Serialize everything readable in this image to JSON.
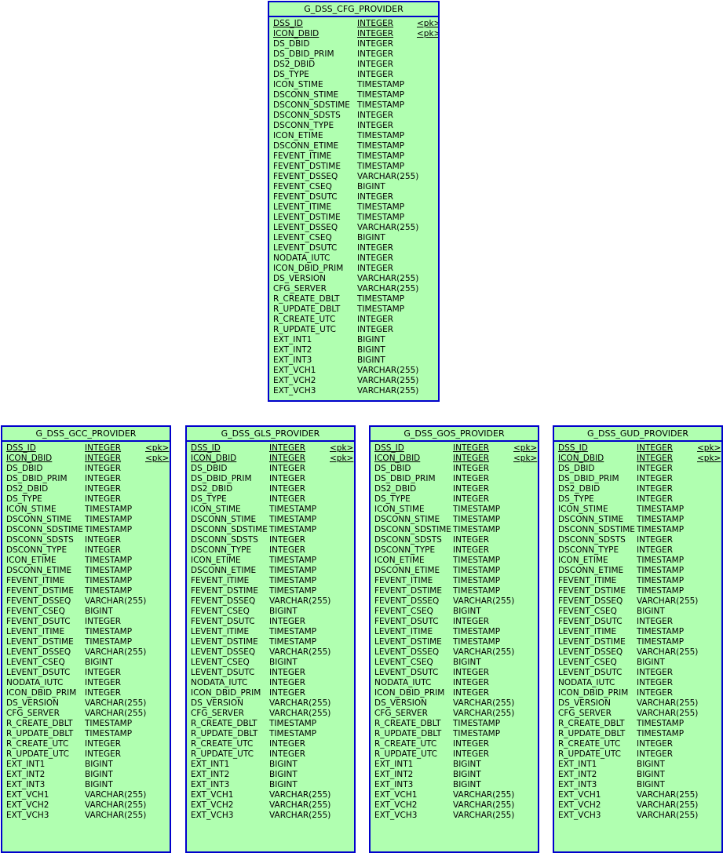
{
  "diagram": {
    "type": "entity-relationship-diagram",
    "entity_fill_color": "#b0ffb0",
    "entity_border_color": "#0000cc",
    "background_color": "#ffffff",
    "key_marker": "<pk>"
  },
  "entities": [
    {
      "id": "cfg",
      "name": "G_DSS_CFG_PROVIDER",
      "attributes": [
        {
          "name": "DSS_ID",
          "type": "INTEGER",
          "key": "<pk>"
        },
        {
          "name": "ICON_DBID",
          "type": "INTEGER",
          "key": "<pk>"
        },
        {
          "name": "DS_DBID",
          "type": "INTEGER",
          "key": ""
        },
        {
          "name": "DS_DBID_PRIM",
          "type": "INTEGER",
          "key": ""
        },
        {
          "name": "DS2_DBID",
          "type": "INTEGER",
          "key": ""
        },
        {
          "name": "DS_TYPE",
          "type": "INTEGER",
          "key": ""
        },
        {
          "name": "ICON_STIME",
          "type": "TIMESTAMP",
          "key": ""
        },
        {
          "name": "DSCONN_STIME",
          "type": "TIMESTAMP",
          "key": ""
        },
        {
          "name": "DSCONN_SDSTIME",
          "type": "TIMESTAMP",
          "key": ""
        },
        {
          "name": "DSCONN_SDSTS",
          "type": "INTEGER",
          "key": ""
        },
        {
          "name": "DSCONN_TYPE",
          "type": "INTEGER",
          "key": ""
        },
        {
          "name": "ICON_ETIME",
          "type": "TIMESTAMP",
          "key": ""
        },
        {
          "name": "DSCONN_ETIME",
          "type": "TIMESTAMP",
          "key": ""
        },
        {
          "name": "FEVENT_ITIME",
          "type": "TIMESTAMP",
          "key": ""
        },
        {
          "name": "FEVENT_DSTIME",
          "type": "TIMESTAMP",
          "key": ""
        },
        {
          "name": "FEVENT_DSSEQ",
          "type": "VARCHAR(255)",
          "key": ""
        },
        {
          "name": "FEVENT_CSEQ",
          "type": "BIGINT",
          "key": ""
        },
        {
          "name": "FEVENT_DSUTC",
          "type": "INTEGER",
          "key": ""
        },
        {
          "name": "LEVENT_ITIME",
          "type": "TIMESTAMP",
          "key": ""
        },
        {
          "name": "LEVENT_DSTIME",
          "type": "TIMESTAMP",
          "key": ""
        },
        {
          "name": "LEVENT_DSSEQ",
          "type": "VARCHAR(255)",
          "key": ""
        },
        {
          "name": "LEVENT_CSEQ",
          "type": "BIGINT",
          "key": ""
        },
        {
          "name": "LEVENT_DSUTC",
          "type": "INTEGER",
          "key": ""
        },
        {
          "name": "NODATA_IUTC",
          "type": "INTEGER",
          "key": ""
        },
        {
          "name": "ICON_DBID_PRIM",
          "type": "INTEGER",
          "key": ""
        },
        {
          "name": "DS_VERSION",
          "type": "VARCHAR(255)",
          "key": ""
        },
        {
          "name": "CFG_SERVER",
          "type": "VARCHAR(255)",
          "key": ""
        },
        {
          "name": "R_CREATE_DBLT",
          "type": "TIMESTAMP",
          "key": ""
        },
        {
          "name": "R_UPDATE_DBLT",
          "type": "TIMESTAMP",
          "key": ""
        },
        {
          "name": "R_CREATE_UTC",
          "type": "INTEGER",
          "key": ""
        },
        {
          "name": "R_UPDATE_UTC",
          "type": "INTEGER",
          "key": ""
        },
        {
          "name": "EXT_INT1",
          "type": "BIGINT",
          "key": ""
        },
        {
          "name": "EXT_INT2",
          "type": "BIGINT",
          "key": ""
        },
        {
          "name": "EXT_INT3",
          "type": "BIGINT",
          "key": ""
        },
        {
          "name": "EXT_VCH1",
          "type": "VARCHAR(255)",
          "key": ""
        },
        {
          "name": "EXT_VCH2",
          "type": "VARCHAR(255)",
          "key": ""
        },
        {
          "name": "EXT_VCH3",
          "type": "VARCHAR(255)",
          "key": ""
        }
      ]
    },
    {
      "id": "gcc",
      "name": "G_DSS_GCC_PROVIDER",
      "attributes": [
        {
          "name": "DSS_ID",
          "type": "INTEGER",
          "key": "<pk>"
        },
        {
          "name": "ICON_DBID",
          "type": "INTEGER",
          "key": "<pk>"
        },
        {
          "name": "DS_DBID",
          "type": "INTEGER",
          "key": ""
        },
        {
          "name": "DS_DBID_PRIM",
          "type": "INTEGER",
          "key": ""
        },
        {
          "name": "DS2_DBID",
          "type": "INTEGER",
          "key": ""
        },
        {
          "name": "DS_TYPE",
          "type": "INTEGER",
          "key": ""
        },
        {
          "name": "ICON_STIME",
          "type": "TIMESTAMP",
          "key": ""
        },
        {
          "name": "DSCONN_STIME",
          "type": "TIMESTAMP",
          "key": ""
        },
        {
          "name": "DSCONN_SDSTIME",
          "type": "TIMESTAMP",
          "key": ""
        },
        {
          "name": "DSCONN_SDSTS",
          "type": "INTEGER",
          "key": ""
        },
        {
          "name": "DSCONN_TYPE",
          "type": "INTEGER",
          "key": ""
        },
        {
          "name": "ICON_ETIME",
          "type": "TIMESTAMP",
          "key": ""
        },
        {
          "name": "DSCONN_ETIME",
          "type": "TIMESTAMP",
          "key": ""
        },
        {
          "name": "FEVENT_ITIME",
          "type": "TIMESTAMP",
          "key": ""
        },
        {
          "name": "FEVENT_DSTIME",
          "type": "TIMESTAMP",
          "key": ""
        },
        {
          "name": "FEVENT_DSSEQ",
          "type": "VARCHAR(255)",
          "key": ""
        },
        {
          "name": "FEVENT_CSEQ",
          "type": "BIGINT",
          "key": ""
        },
        {
          "name": "FEVENT_DSUTC",
          "type": "INTEGER",
          "key": ""
        },
        {
          "name": "LEVENT_ITIME",
          "type": "TIMESTAMP",
          "key": ""
        },
        {
          "name": "LEVENT_DSTIME",
          "type": "TIMESTAMP",
          "key": ""
        },
        {
          "name": "LEVENT_DSSEQ",
          "type": "VARCHAR(255)",
          "key": ""
        },
        {
          "name": "LEVENT_CSEQ",
          "type": "BIGINT",
          "key": ""
        },
        {
          "name": "LEVENT_DSUTC",
          "type": "INTEGER",
          "key": ""
        },
        {
          "name": "NODATA_IUTC",
          "type": "INTEGER",
          "key": ""
        },
        {
          "name": "ICON_DBID_PRIM",
          "type": "INTEGER",
          "key": ""
        },
        {
          "name": "DS_VERSION",
          "type": "VARCHAR(255)",
          "key": ""
        },
        {
          "name": "CFG_SERVER",
          "type": "VARCHAR(255)",
          "key": ""
        },
        {
          "name": "R_CREATE_DBLT",
          "type": "TIMESTAMP",
          "key": ""
        },
        {
          "name": "R_UPDATE_DBLT",
          "type": "TIMESTAMP",
          "key": ""
        },
        {
          "name": "R_CREATE_UTC",
          "type": "INTEGER",
          "key": ""
        },
        {
          "name": "R_UPDATE_UTC",
          "type": "INTEGER",
          "key": ""
        },
        {
          "name": "EXT_INT1",
          "type": "BIGINT",
          "key": ""
        },
        {
          "name": "EXT_INT2",
          "type": "BIGINT",
          "key": ""
        },
        {
          "name": "EXT_INT3",
          "type": "BIGINT",
          "key": ""
        },
        {
          "name": "EXT_VCH1",
          "type": "VARCHAR(255)",
          "key": ""
        },
        {
          "name": "EXT_VCH2",
          "type": "VARCHAR(255)",
          "key": ""
        },
        {
          "name": "EXT_VCH3",
          "type": "VARCHAR(255)",
          "key": ""
        }
      ]
    },
    {
      "id": "gls",
      "name": "G_DSS_GLS_PROVIDER",
      "attributes": [
        {
          "name": "DSS_ID",
          "type": "INTEGER",
          "key": "<pk>"
        },
        {
          "name": "ICON_DBID",
          "type": "INTEGER",
          "key": "<pk>"
        },
        {
          "name": "DS_DBID",
          "type": "INTEGER",
          "key": ""
        },
        {
          "name": "DS_DBID_PRIM",
          "type": "INTEGER",
          "key": ""
        },
        {
          "name": "DS2_DBID",
          "type": "INTEGER",
          "key": ""
        },
        {
          "name": "DS_TYPE",
          "type": "INTEGER",
          "key": ""
        },
        {
          "name": "ICON_STIME",
          "type": "TIMESTAMP",
          "key": ""
        },
        {
          "name": "DSCONN_STIME",
          "type": "TIMESTAMP",
          "key": ""
        },
        {
          "name": "DSCONN_SDSTIME",
          "type": "TIMESTAMP",
          "key": ""
        },
        {
          "name": "DSCONN_SDSTS",
          "type": "INTEGER",
          "key": ""
        },
        {
          "name": "DSCONN_TYPE",
          "type": "INTEGER",
          "key": ""
        },
        {
          "name": "ICON_ETIME",
          "type": "TIMESTAMP",
          "key": ""
        },
        {
          "name": "DSCONN_ETIME",
          "type": "TIMESTAMP",
          "key": ""
        },
        {
          "name": "FEVENT_ITIME",
          "type": "TIMESTAMP",
          "key": ""
        },
        {
          "name": "FEVENT_DSTIME",
          "type": "TIMESTAMP",
          "key": ""
        },
        {
          "name": "FEVENT_DSSEQ",
          "type": "VARCHAR(255)",
          "key": ""
        },
        {
          "name": "FEVENT_CSEQ",
          "type": "BIGINT",
          "key": ""
        },
        {
          "name": "FEVENT_DSUTC",
          "type": "INTEGER",
          "key": ""
        },
        {
          "name": "LEVENT_ITIME",
          "type": "TIMESTAMP",
          "key": ""
        },
        {
          "name": "LEVENT_DSTIME",
          "type": "TIMESTAMP",
          "key": ""
        },
        {
          "name": "LEVENT_DSSEQ",
          "type": "VARCHAR(255)",
          "key": ""
        },
        {
          "name": "LEVENT_CSEQ",
          "type": "BIGINT",
          "key": ""
        },
        {
          "name": "LEVENT_DSUTC",
          "type": "INTEGER",
          "key": ""
        },
        {
          "name": "NODATA_IUTC",
          "type": "INTEGER",
          "key": ""
        },
        {
          "name": "ICON_DBID_PRIM",
          "type": "INTEGER",
          "key": ""
        },
        {
          "name": "DS_VERSION",
          "type": "VARCHAR(255)",
          "key": ""
        },
        {
          "name": "CFG_SERVER",
          "type": "VARCHAR(255)",
          "key": ""
        },
        {
          "name": "R_CREATE_DBLT",
          "type": "TIMESTAMP",
          "key": ""
        },
        {
          "name": "R_UPDATE_DBLT",
          "type": "TIMESTAMP",
          "key": ""
        },
        {
          "name": "R_CREATE_UTC",
          "type": "INTEGER",
          "key": ""
        },
        {
          "name": "R_UPDATE_UTC",
          "type": "INTEGER",
          "key": ""
        },
        {
          "name": "EXT_INT1",
          "type": "BIGINT",
          "key": ""
        },
        {
          "name": "EXT_INT2",
          "type": "BIGINT",
          "key": ""
        },
        {
          "name": "EXT_INT3",
          "type": "BIGINT",
          "key": ""
        },
        {
          "name": "EXT_VCH1",
          "type": "VARCHAR(255)",
          "key": ""
        },
        {
          "name": "EXT_VCH2",
          "type": "VARCHAR(255)",
          "key": ""
        },
        {
          "name": "EXT_VCH3",
          "type": "VARCHAR(255)",
          "key": ""
        }
      ]
    },
    {
      "id": "gos",
      "name": "G_DSS_GOS_PROVIDER",
      "attributes": [
        {
          "name": "DSS_ID",
          "type": "INTEGER",
          "key": "<pk>"
        },
        {
          "name": "ICON_DBID",
          "type": "INTEGER",
          "key": "<pk>"
        },
        {
          "name": "DS_DBID",
          "type": "INTEGER",
          "key": ""
        },
        {
          "name": "DS_DBID_PRIM",
          "type": "INTEGER",
          "key": ""
        },
        {
          "name": "DS2_DBID",
          "type": "INTEGER",
          "key": ""
        },
        {
          "name": "DS_TYPE",
          "type": "INTEGER",
          "key": ""
        },
        {
          "name": "ICON_STIME",
          "type": "TIMESTAMP",
          "key": ""
        },
        {
          "name": "DSCONN_STIME",
          "type": "TIMESTAMP",
          "key": ""
        },
        {
          "name": "DSCONN_SDSTIME",
          "type": "TIMESTAMP",
          "key": ""
        },
        {
          "name": "DSCONN_SDSTS",
          "type": "INTEGER",
          "key": ""
        },
        {
          "name": "DSCONN_TYPE",
          "type": "INTEGER",
          "key": ""
        },
        {
          "name": "ICON_ETIME",
          "type": "TIMESTAMP",
          "key": ""
        },
        {
          "name": "DSCONN_ETIME",
          "type": "TIMESTAMP",
          "key": ""
        },
        {
          "name": "FEVENT_ITIME",
          "type": "TIMESTAMP",
          "key": ""
        },
        {
          "name": "FEVENT_DSTIME",
          "type": "TIMESTAMP",
          "key": ""
        },
        {
          "name": "FEVENT_DSSEQ",
          "type": "VARCHAR(255)",
          "key": ""
        },
        {
          "name": "FEVENT_CSEQ",
          "type": "BIGINT",
          "key": ""
        },
        {
          "name": "FEVENT_DSUTC",
          "type": "INTEGER",
          "key": ""
        },
        {
          "name": "LEVENT_ITIME",
          "type": "TIMESTAMP",
          "key": ""
        },
        {
          "name": "LEVENT_DSTIME",
          "type": "TIMESTAMP",
          "key": ""
        },
        {
          "name": "LEVENT_DSSEQ",
          "type": "VARCHAR(255)",
          "key": ""
        },
        {
          "name": "LEVENT_CSEQ",
          "type": "BIGINT",
          "key": ""
        },
        {
          "name": "LEVENT_DSUTC",
          "type": "INTEGER",
          "key": ""
        },
        {
          "name": "NODATA_IUTC",
          "type": "INTEGER",
          "key": ""
        },
        {
          "name": "ICON_DBID_PRIM",
          "type": "INTEGER",
          "key": ""
        },
        {
          "name": "DS_VERSION",
          "type": "VARCHAR(255)",
          "key": ""
        },
        {
          "name": "CFG_SERVER",
          "type": "VARCHAR(255)",
          "key": ""
        },
        {
          "name": "R_CREATE_DBLT",
          "type": "TIMESTAMP",
          "key": ""
        },
        {
          "name": "R_UPDATE_DBLT",
          "type": "TIMESTAMP",
          "key": ""
        },
        {
          "name": "R_CREATE_UTC",
          "type": "INTEGER",
          "key": ""
        },
        {
          "name": "R_UPDATE_UTC",
          "type": "INTEGER",
          "key": ""
        },
        {
          "name": "EXT_INT1",
          "type": "BIGINT",
          "key": ""
        },
        {
          "name": "EXT_INT2",
          "type": "BIGINT",
          "key": ""
        },
        {
          "name": "EXT_INT3",
          "type": "BIGINT",
          "key": ""
        },
        {
          "name": "EXT_VCH1",
          "type": "VARCHAR(255)",
          "key": ""
        },
        {
          "name": "EXT_VCH2",
          "type": "VARCHAR(255)",
          "key": ""
        },
        {
          "name": "EXT_VCH3",
          "type": "VARCHAR(255)",
          "key": ""
        }
      ]
    },
    {
      "id": "gud",
      "name": "G_DSS_GUD_PROVIDER",
      "attributes": [
        {
          "name": "DSS_ID",
          "type": "INTEGER",
          "key": "<pk>"
        },
        {
          "name": "ICON_DBID",
          "type": "INTEGER",
          "key": "<pk>"
        },
        {
          "name": "DS_DBID",
          "type": "INTEGER",
          "key": ""
        },
        {
          "name": "DS_DBID_PRIM",
          "type": "INTEGER",
          "key": ""
        },
        {
          "name": "DS2_DBID",
          "type": "INTEGER",
          "key": ""
        },
        {
          "name": "DS_TYPE",
          "type": "INTEGER",
          "key": ""
        },
        {
          "name": "ICON_STIME",
          "type": "TIMESTAMP",
          "key": ""
        },
        {
          "name": "DSCONN_STIME",
          "type": "TIMESTAMP",
          "key": ""
        },
        {
          "name": "DSCONN_SDSTIME",
          "type": "TIMESTAMP",
          "key": ""
        },
        {
          "name": "DSCONN_SDSTS",
          "type": "INTEGER",
          "key": ""
        },
        {
          "name": "DSCONN_TYPE",
          "type": "INTEGER",
          "key": ""
        },
        {
          "name": "ICON_ETIME",
          "type": "TIMESTAMP",
          "key": ""
        },
        {
          "name": "DSCONN_ETIME",
          "type": "TIMESTAMP",
          "key": ""
        },
        {
          "name": "FEVENT_ITIME",
          "type": "TIMESTAMP",
          "key": ""
        },
        {
          "name": "FEVENT_DSTIME",
          "type": "TIMESTAMP",
          "key": ""
        },
        {
          "name": "FEVENT_DSSEQ",
          "type": "VARCHAR(255)",
          "key": ""
        },
        {
          "name": "FEVENT_CSEQ",
          "type": "BIGINT",
          "key": ""
        },
        {
          "name": "FEVENT_DSUTC",
          "type": "INTEGER",
          "key": ""
        },
        {
          "name": "LEVENT_ITIME",
          "type": "TIMESTAMP",
          "key": ""
        },
        {
          "name": "LEVENT_DSTIME",
          "type": "TIMESTAMP",
          "key": ""
        },
        {
          "name": "LEVENT_DSSEQ",
          "type": "VARCHAR(255)",
          "key": ""
        },
        {
          "name": "LEVENT_CSEQ",
          "type": "BIGINT",
          "key": ""
        },
        {
          "name": "LEVENT_DSUTC",
          "type": "INTEGER",
          "key": ""
        },
        {
          "name": "NODATA_IUTC",
          "type": "INTEGER",
          "key": ""
        },
        {
          "name": "ICON_DBID_PRIM",
          "type": "INTEGER",
          "key": ""
        },
        {
          "name": "DS_VERSION",
          "type": "VARCHAR(255)",
          "key": ""
        },
        {
          "name": "CFG_SERVER",
          "type": "VARCHAR(255)",
          "key": ""
        },
        {
          "name": "R_CREATE_DBLT",
          "type": "TIMESTAMP",
          "key": ""
        },
        {
          "name": "R_UPDATE_DBLT",
          "type": "TIMESTAMP",
          "key": ""
        },
        {
          "name": "R_CREATE_UTC",
          "type": "INTEGER",
          "key": ""
        },
        {
          "name": "R_UPDATE_UTC",
          "type": "INTEGER",
          "key": ""
        },
        {
          "name": "EXT_INT1",
          "type": "BIGINT",
          "key": ""
        },
        {
          "name": "EXT_INT2",
          "type": "BIGINT",
          "key": ""
        },
        {
          "name": "EXT_INT3",
          "type": "BIGINT",
          "key": ""
        },
        {
          "name": "EXT_VCH1",
          "type": "VARCHAR(255)",
          "key": ""
        },
        {
          "name": "EXT_VCH2",
          "type": "VARCHAR(255)",
          "key": ""
        },
        {
          "name": "EXT_VCH3",
          "type": "VARCHAR(255)",
          "key": ""
        }
      ]
    }
  ]
}
